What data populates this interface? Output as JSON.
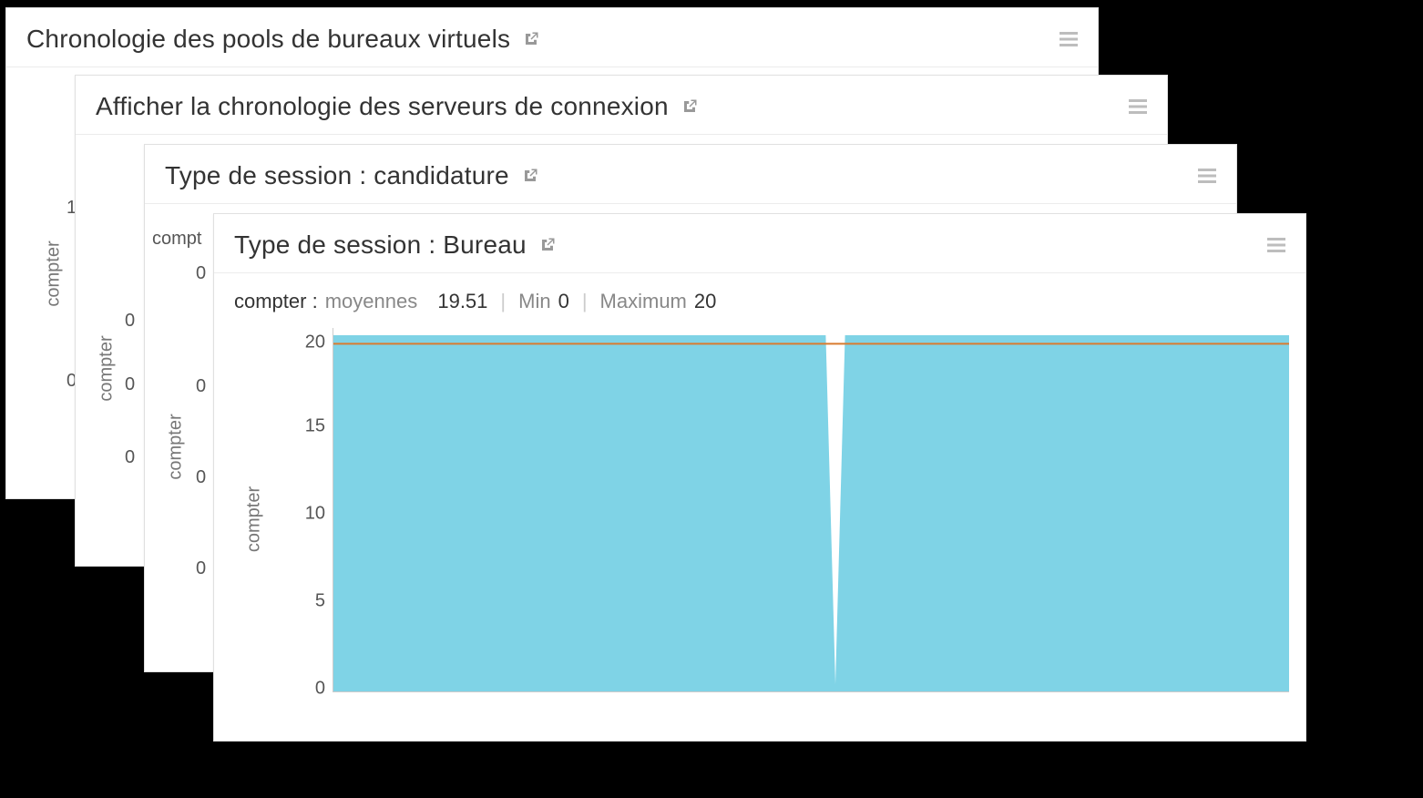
{
  "panels": [
    {
      "title": "Chronologie des pools de bureaux virtuels",
      "ylabel": "compter",
      "ticks": [
        "1",
        "0"
      ]
    },
    {
      "title": "Afficher la chronologie des serveurs de connexion",
      "ylabel": "compter",
      "ticks": [
        "0",
        "0",
        "0"
      ]
    },
    {
      "title": "Type de session : candidature",
      "ylabel": "compter",
      "ticks": [
        "0",
        "0",
        "0",
        "0"
      ],
      "stat_prefix": "compt"
    },
    {
      "title": "Type de session : Bureau",
      "ylabel": "compter"
    }
  ],
  "foreground": {
    "stats": {
      "label": "compter :",
      "avg_key": "moyennes",
      "avg_val": "19.51",
      "min_key": "Min",
      "min_val": "0",
      "max_key": "Maximum",
      "max_val": "20"
    },
    "yticks": [
      "20",
      "15",
      "10",
      "5",
      "0"
    ]
  },
  "chart_data": {
    "type": "area",
    "title": "Type de session : Bureau",
    "ylabel": "compter",
    "ylim": [
      0,
      20
    ],
    "x_count": 100,
    "series": [
      {
        "name": "compter",
        "values": [
          20,
          20,
          20,
          20,
          20,
          20,
          20,
          20,
          20,
          20,
          20,
          20,
          20,
          20,
          20,
          20,
          20,
          20,
          20,
          20,
          20,
          20,
          20,
          20,
          20,
          20,
          20,
          20,
          20,
          20,
          20,
          20,
          20,
          20,
          20,
          20,
          20,
          20,
          20,
          20,
          20,
          20,
          20,
          20,
          20,
          20,
          20,
          20,
          20,
          20,
          20,
          20,
          0,
          20,
          20,
          20,
          20,
          20,
          20,
          20,
          20,
          20,
          20,
          20,
          20,
          20,
          20,
          20,
          20,
          20,
          20,
          20,
          20,
          20,
          20,
          20,
          20,
          20,
          20,
          20,
          20,
          20,
          20,
          20,
          20,
          20,
          20,
          20,
          20,
          20,
          20,
          20,
          20,
          20,
          20,
          20,
          20,
          20,
          20,
          20
        ]
      }
    ],
    "avg_line": 19.51,
    "colors": {
      "area": "#7fd3e6",
      "avg_line": "#d97b2f"
    }
  }
}
